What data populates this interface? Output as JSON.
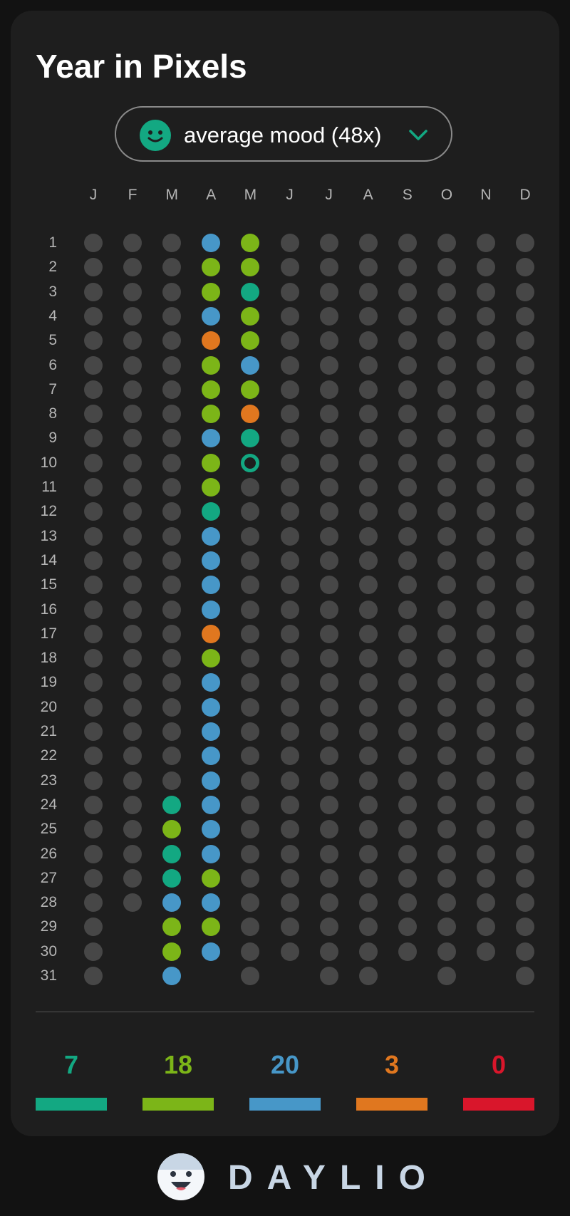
{
  "title": "Year in Pixels",
  "mood_selector": {
    "label": "average mood (48x)",
    "face_icon": "smiley-face-icon",
    "chevron_icon": "chevron-down-icon",
    "accent": "#13a882"
  },
  "months": [
    "J",
    "F",
    "M",
    "A",
    "M",
    "J",
    "J",
    "A",
    "S",
    "O",
    "N",
    "D"
  ],
  "days_in_month": [
    31,
    28,
    31,
    30,
    31,
    30,
    31,
    31,
    30,
    31,
    30,
    31
  ],
  "empty_color": "#474747",
  "mood_colors": {
    "rad": "#13a882",
    "good": "#7cb518",
    "meh": "#4797c8",
    "bad": "#e0771f",
    "awful": "#d9162b"
  },
  "filled_days": {
    "2": [
      "rad",
      "good",
      "rad",
      "rad",
      "meh",
      "good",
      "good",
      "meh"
    ],
    "3": [
      "meh",
      "good",
      "good",
      "meh",
      "bad",
      "good",
      "good",
      "good",
      "meh",
      "good",
      "good",
      "rad",
      "meh",
      "meh",
      "meh",
      "meh",
      "bad",
      "good",
      "meh",
      "meh",
      "meh",
      "meh",
      "meh",
      "meh",
      "meh",
      "meh",
      "good",
      "meh",
      "good",
      "meh"
    ],
    "4": [
      "good",
      "good",
      "rad",
      "good",
      "good",
      "meh",
      "good",
      "bad",
      "rad",
      "today"
    ]
  },
  "filled_start_day": {
    "2": 24,
    "3": 1,
    "4": 1
  },
  "stats": [
    {
      "count": "7",
      "color": "#13a882"
    },
    {
      "count": "18",
      "color": "#7cb518"
    },
    {
      "count": "20",
      "color": "#4797c8"
    },
    {
      "count": "3",
      "color": "#e0771f"
    },
    {
      "count": "0",
      "color": "#d9162b"
    }
  ],
  "footer": {
    "logo_text": "DAYLIO",
    "logo_icon": "daylio-face-icon"
  }
}
